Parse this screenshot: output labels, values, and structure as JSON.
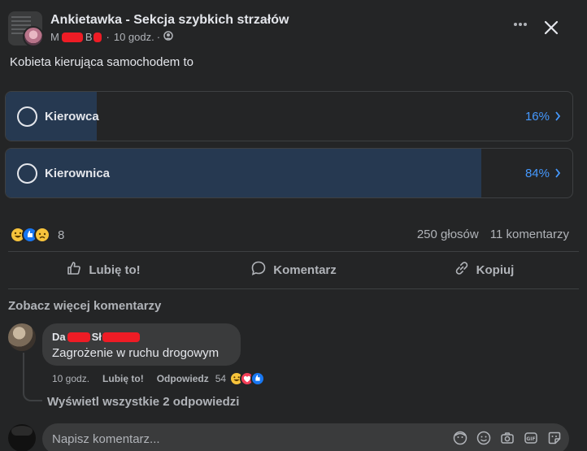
{
  "post": {
    "group_name": "Ankietawka - Sekcja szybkich strzałów",
    "author_prefix": "M",
    "author_mid": "B",
    "time": "10 godz.",
    "question": "Kobieta kierująca samochodem to"
  },
  "poll": {
    "options": [
      {
        "label": "Kierowca",
        "percent_label": "16%",
        "percent": 16
      },
      {
        "label": "Kierownica",
        "percent_label": "84%",
        "percent": 84
      }
    ]
  },
  "reactions": {
    "icons": [
      "haha-icon",
      "like-icon",
      "sad-icon"
    ],
    "count": "8",
    "votes": "250 głosów",
    "comments": "11 komentarzy"
  },
  "actions": {
    "like": "Lubię to!",
    "comment": "Komentarz",
    "share": "Kopiuj"
  },
  "comments": {
    "see_more": "Zobacz więcej komentarzy",
    "items": [
      {
        "author_prefix": "Da",
        "author_mid": "Sł",
        "text": "Zagrożenie w ruchu drogowym",
        "time": "10 godz.",
        "like": "Lubię to!",
        "reply": "Odpowiedz",
        "reaction_count": "54"
      }
    ],
    "view_replies": "Wyświetl wszystkie 2 odpowiedzi"
  },
  "composer": {
    "placeholder": "Napisz komentarz..."
  },
  "colors": {
    "background": "#242526",
    "poll_fill": "#263951",
    "accent": "#4599ff",
    "redaction": "#ee1c25"
  }
}
